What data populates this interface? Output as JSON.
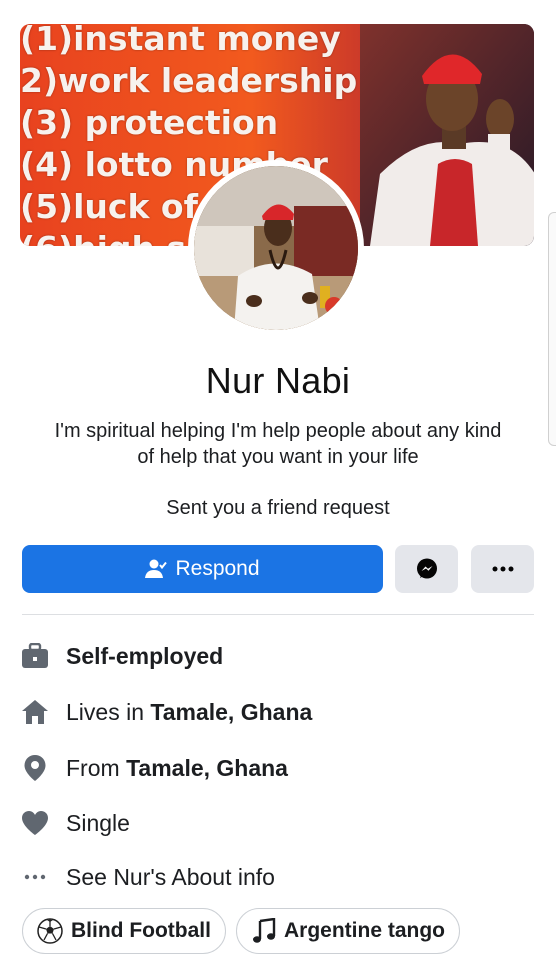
{
  "cover": {
    "lines": [
      "(1)instant money",
      "2)work leadership",
      "(3) protection",
      "(4) lotto number",
      "(5)luck of",
      "(6)high s"
    ]
  },
  "profile": {
    "name": "Nur Nabi",
    "bio": "I'm spiritual helping I'm help people about any kind of help that you want in your life",
    "friend_request": "Sent you a friend request"
  },
  "actions": {
    "respond_label": "Respond",
    "respond_icon": "person-respond-icon",
    "message_icon": "messenger-icon",
    "more_icon": "more-dots-icon"
  },
  "info": {
    "work": {
      "icon": "briefcase-icon",
      "text": "Self-employed"
    },
    "lives": {
      "icon": "home-icon",
      "prefix": "Lives in ",
      "place": "Tamale, Ghana"
    },
    "from": {
      "icon": "location-pin-icon",
      "prefix": "From ",
      "place": "Tamale, Ghana"
    },
    "relationship": {
      "icon": "heart-icon",
      "text": "Single"
    },
    "about": {
      "icon": "more-dots-icon",
      "text": "See Nur's About info"
    }
  },
  "interests": [
    {
      "icon": "soccer-ball-icon",
      "label": "Blind Football"
    },
    {
      "icon": "music-note-icon",
      "label": "Argentine tango"
    }
  ],
  "colors": {
    "primary_blue": "#1b74e4",
    "secondary_button": "#e4e6eb",
    "icon_gray": "#606770"
  }
}
